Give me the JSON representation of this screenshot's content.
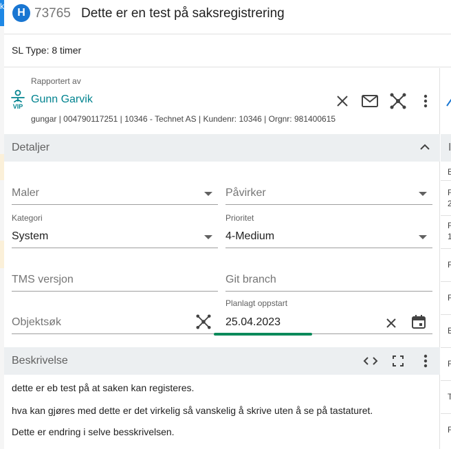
{
  "background": {
    "corner_char": "k"
  },
  "header": {
    "badge": "H",
    "case_number": "73765",
    "title": "Dette er en test på saksregistrering"
  },
  "sl_type": "SL Type: 8 timer",
  "reporter": {
    "label": "Rapportert av",
    "vip_label": "VIP",
    "name": "Gunn Garvik",
    "info": "gungar | 004790117251 | 10346 - Technet AS | Kundenr: 10346 | Orgnr: 981400615"
  },
  "details": {
    "title": "Detaljer",
    "maler": {
      "placeholder": "Maler"
    },
    "pavirker": {
      "placeholder": "Påvirker"
    },
    "kategori": {
      "label": "Kategori",
      "value": "System"
    },
    "prioritet": {
      "label": "Prioritet",
      "value": "4-Medium"
    },
    "tms": {
      "placeholder": "TMS versjon"
    },
    "git": {
      "placeholder": "Git branch"
    },
    "objektsok": {
      "placeholder": "Objektsøk"
    },
    "planlagt": {
      "label": "Planlagt oppstart",
      "value": "25.04.2023"
    }
  },
  "description": {
    "title": "Beskrivelse",
    "lines": [
      "dette er eb test på at saken kan registeres.",
      "hva kan gjøres med dette er det virkelig så vanskelig å skrive uten  å se på tastaturet.",
      "Dette er endring i selve besskrivelsen."
    ]
  },
  "right_panel": {
    "header_char": "I",
    "rows": [
      "E",
      "F\n2",
      "F\n1",
      "F",
      "F",
      "E",
      "F",
      "T",
      "F"
    ]
  },
  "colors": {
    "accent": "#1976d2",
    "teal": "#00838f",
    "focus": "#0b8a5a",
    "section_bg": "#eceff1"
  }
}
